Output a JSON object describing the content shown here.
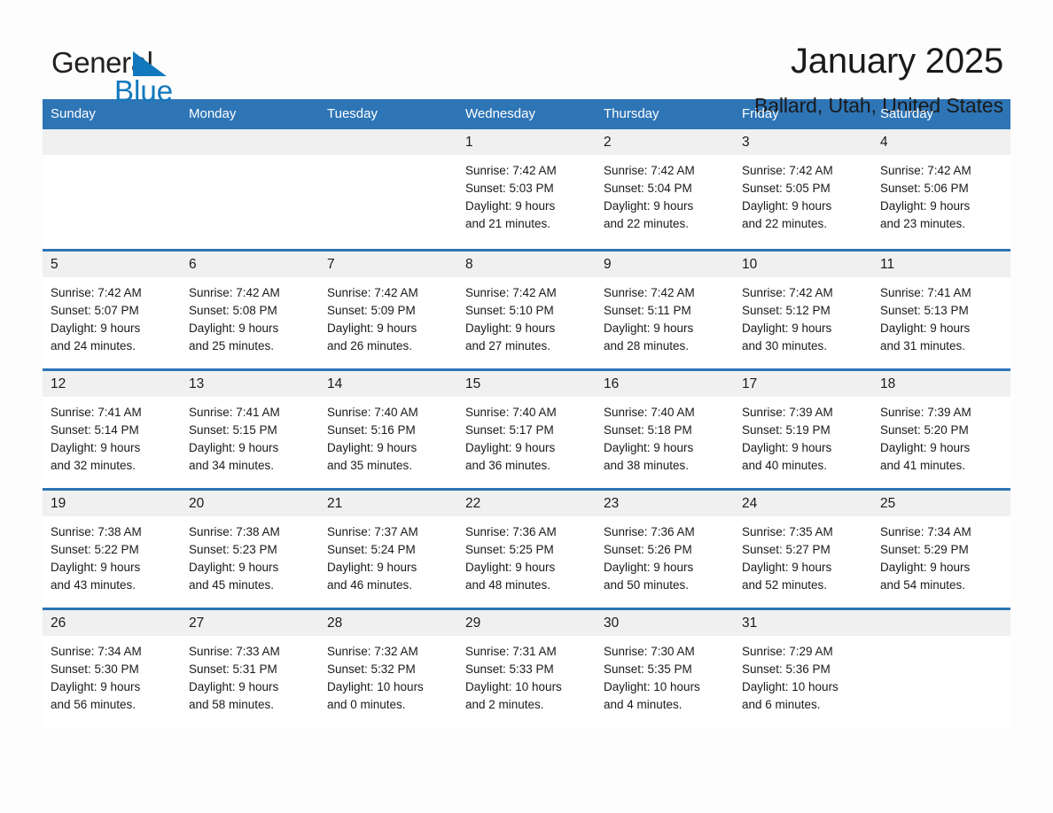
{
  "brand": {
    "name_part1": "General",
    "name_part2": "Blue",
    "triangle_color": "#1278be",
    "text_color": "#231f20"
  },
  "header": {
    "title": "January 2025",
    "subtitle": "Ballard, Utah, United States"
  },
  "theme": {
    "header_blue": "#2e75b6",
    "daynum_gray": "#f0f0f0",
    "page_background": "#fdfdfd",
    "text": "#1a1a1a"
  },
  "weekday_headers": [
    "Sunday",
    "Monday",
    "Tuesday",
    "Wednesday",
    "Thursday",
    "Friday",
    "Saturday"
  ],
  "labels": {
    "sunrise_prefix": "Sunrise: ",
    "sunset_prefix": "Sunset: ",
    "daylight_prefix": "Daylight: "
  },
  "weeks": [
    [
      {
        "day": "",
        "empty": true
      },
      {
        "day": "",
        "empty": true
      },
      {
        "day": "",
        "empty": true
      },
      {
        "day": "1",
        "sunrise": "Sunrise: 7:42 AM",
        "sunset": "Sunset: 5:03 PM",
        "daylight_line1": "Daylight: 9 hours",
        "daylight_line2": "and 21 minutes."
      },
      {
        "day": "2",
        "sunrise": "Sunrise: 7:42 AM",
        "sunset": "Sunset: 5:04 PM",
        "daylight_line1": "Daylight: 9 hours",
        "daylight_line2": "and 22 minutes."
      },
      {
        "day": "3",
        "sunrise": "Sunrise: 7:42 AM",
        "sunset": "Sunset: 5:05 PM",
        "daylight_line1": "Daylight: 9 hours",
        "daylight_line2": "and 22 minutes."
      },
      {
        "day": "4",
        "sunrise": "Sunrise: 7:42 AM",
        "sunset": "Sunset: 5:06 PM",
        "daylight_line1": "Daylight: 9 hours",
        "daylight_line2": "and 23 minutes."
      }
    ],
    [
      {
        "day": "5",
        "sunrise": "Sunrise: 7:42 AM",
        "sunset": "Sunset: 5:07 PM",
        "daylight_line1": "Daylight: 9 hours",
        "daylight_line2": "and 24 minutes."
      },
      {
        "day": "6",
        "sunrise": "Sunrise: 7:42 AM",
        "sunset": "Sunset: 5:08 PM",
        "daylight_line1": "Daylight: 9 hours",
        "daylight_line2": "and 25 minutes."
      },
      {
        "day": "7",
        "sunrise": "Sunrise: 7:42 AM",
        "sunset": "Sunset: 5:09 PM",
        "daylight_line1": "Daylight: 9 hours",
        "daylight_line2": "and 26 minutes."
      },
      {
        "day": "8",
        "sunrise": "Sunrise: 7:42 AM",
        "sunset": "Sunset: 5:10 PM",
        "daylight_line1": "Daylight: 9 hours",
        "daylight_line2": "and 27 minutes."
      },
      {
        "day": "9",
        "sunrise": "Sunrise: 7:42 AM",
        "sunset": "Sunset: 5:11 PM",
        "daylight_line1": "Daylight: 9 hours",
        "daylight_line2": "and 28 minutes."
      },
      {
        "day": "10",
        "sunrise": "Sunrise: 7:42 AM",
        "sunset": "Sunset: 5:12 PM",
        "daylight_line1": "Daylight: 9 hours",
        "daylight_line2": "and 30 minutes."
      },
      {
        "day": "11",
        "sunrise": "Sunrise: 7:41 AM",
        "sunset": "Sunset: 5:13 PM",
        "daylight_line1": "Daylight: 9 hours",
        "daylight_line2": "and 31 minutes."
      }
    ],
    [
      {
        "day": "12",
        "sunrise": "Sunrise: 7:41 AM",
        "sunset": "Sunset: 5:14 PM",
        "daylight_line1": "Daylight: 9 hours",
        "daylight_line2": "and 32 minutes."
      },
      {
        "day": "13",
        "sunrise": "Sunrise: 7:41 AM",
        "sunset": "Sunset: 5:15 PM",
        "daylight_line1": "Daylight: 9 hours",
        "daylight_line2": "and 34 minutes."
      },
      {
        "day": "14",
        "sunrise": "Sunrise: 7:40 AM",
        "sunset": "Sunset: 5:16 PM",
        "daylight_line1": "Daylight: 9 hours",
        "daylight_line2": "and 35 minutes."
      },
      {
        "day": "15",
        "sunrise": "Sunrise: 7:40 AM",
        "sunset": "Sunset: 5:17 PM",
        "daylight_line1": "Daylight: 9 hours",
        "daylight_line2": "and 36 minutes."
      },
      {
        "day": "16",
        "sunrise": "Sunrise: 7:40 AM",
        "sunset": "Sunset: 5:18 PM",
        "daylight_line1": "Daylight: 9 hours",
        "daylight_line2": "and 38 minutes."
      },
      {
        "day": "17",
        "sunrise": "Sunrise: 7:39 AM",
        "sunset": "Sunset: 5:19 PM",
        "daylight_line1": "Daylight: 9 hours",
        "daylight_line2": "and 40 minutes."
      },
      {
        "day": "18",
        "sunrise": "Sunrise: 7:39 AM",
        "sunset": "Sunset: 5:20 PM",
        "daylight_line1": "Daylight: 9 hours",
        "daylight_line2": "and 41 minutes."
      }
    ],
    [
      {
        "day": "19",
        "sunrise": "Sunrise: 7:38 AM",
        "sunset": "Sunset: 5:22 PM",
        "daylight_line1": "Daylight: 9 hours",
        "daylight_line2": "and 43 minutes."
      },
      {
        "day": "20",
        "sunrise": "Sunrise: 7:38 AM",
        "sunset": "Sunset: 5:23 PM",
        "daylight_line1": "Daylight: 9 hours",
        "daylight_line2": "and 45 minutes."
      },
      {
        "day": "21",
        "sunrise": "Sunrise: 7:37 AM",
        "sunset": "Sunset: 5:24 PM",
        "daylight_line1": "Daylight: 9 hours",
        "daylight_line2": "and 46 minutes."
      },
      {
        "day": "22",
        "sunrise": "Sunrise: 7:36 AM",
        "sunset": "Sunset: 5:25 PM",
        "daylight_line1": "Daylight: 9 hours",
        "daylight_line2": "and 48 minutes."
      },
      {
        "day": "23",
        "sunrise": "Sunrise: 7:36 AM",
        "sunset": "Sunset: 5:26 PM",
        "daylight_line1": "Daylight: 9 hours",
        "daylight_line2": "and 50 minutes."
      },
      {
        "day": "24",
        "sunrise": "Sunrise: 7:35 AM",
        "sunset": "Sunset: 5:27 PM",
        "daylight_line1": "Daylight: 9 hours",
        "daylight_line2": "and 52 minutes."
      },
      {
        "day": "25",
        "sunrise": "Sunrise: 7:34 AM",
        "sunset": "Sunset: 5:29 PM",
        "daylight_line1": "Daylight: 9 hours",
        "daylight_line2": "and 54 minutes."
      }
    ],
    [
      {
        "day": "26",
        "sunrise": "Sunrise: 7:34 AM",
        "sunset": "Sunset: 5:30 PM",
        "daylight_line1": "Daylight: 9 hours",
        "daylight_line2": "and 56 minutes."
      },
      {
        "day": "27",
        "sunrise": "Sunrise: 7:33 AM",
        "sunset": "Sunset: 5:31 PM",
        "daylight_line1": "Daylight: 9 hours",
        "daylight_line2": "and 58 minutes."
      },
      {
        "day": "28",
        "sunrise": "Sunrise: 7:32 AM",
        "sunset": "Sunset: 5:32 PM",
        "daylight_line1": "Daylight: 10 hours",
        "daylight_line2": "and 0 minutes."
      },
      {
        "day": "29",
        "sunrise": "Sunrise: 7:31 AM",
        "sunset": "Sunset: 5:33 PM",
        "daylight_line1": "Daylight: 10 hours",
        "daylight_line2": "and 2 minutes."
      },
      {
        "day": "30",
        "sunrise": "Sunrise: 7:30 AM",
        "sunset": "Sunset: 5:35 PM",
        "daylight_line1": "Daylight: 10 hours",
        "daylight_line2": "and 4 minutes."
      },
      {
        "day": "31",
        "sunrise": "Sunrise: 7:29 AM",
        "sunset": "Sunset: 5:36 PM",
        "daylight_line1": "Daylight: 10 hours",
        "daylight_line2": "and 6 minutes."
      },
      {
        "day": "",
        "empty": true
      }
    ]
  ]
}
